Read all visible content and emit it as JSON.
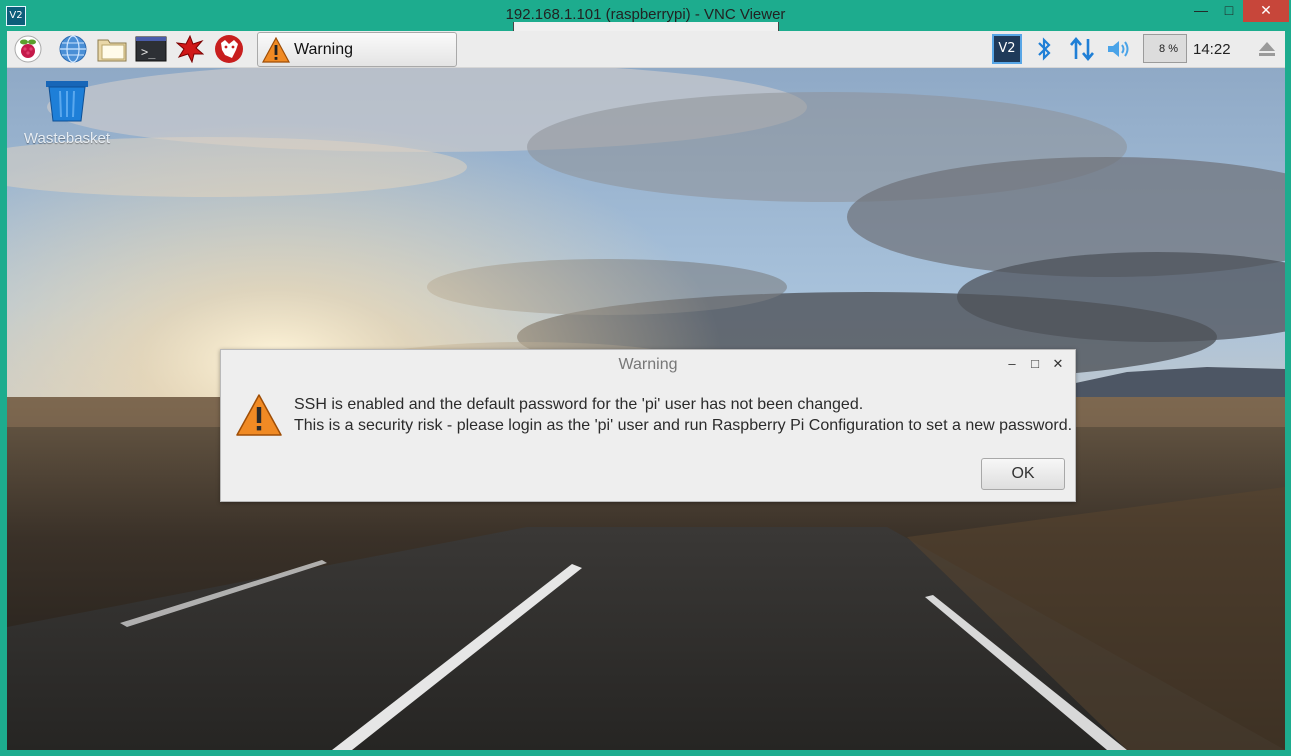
{
  "window": {
    "title": "192.168.1.101 (raspberrypi) - VNC Viewer",
    "app_icon": "V2",
    "controls": {
      "minimize": "—",
      "maximize": "□",
      "close": "✕"
    }
  },
  "panel": {
    "launchers": [
      "raspberry-menu-icon",
      "web-browser-icon",
      "file-manager-icon",
      "terminal-icon",
      "math-kernel-icon",
      "wolfram-icon"
    ],
    "task_button": {
      "label": "Warning",
      "icon": "warning-icon"
    },
    "tray": {
      "vnc_icon": "V2",
      "bluetooth_icon": "bluetooth-icon",
      "network_icon": "network-arrows-icon",
      "volume_icon": "volume-icon",
      "cpu_usage": "8 %",
      "clock": "14:22",
      "eject_icon": "eject-icon"
    }
  },
  "desktop": {
    "icons": [
      {
        "label": "Wastebasket",
        "icon": "wastebasket-icon"
      }
    ]
  },
  "dialog": {
    "title": "Warning",
    "message_line1": "SSH is enabled and the default password for the 'pi' user has not been changed.",
    "message_line2": "This is a security risk - please login as the 'pi' user and run Raspberry Pi Configuration to set a new password.",
    "ok_label": "OK",
    "controls": {
      "minimize": "–",
      "maximize": "□",
      "close": "✕"
    }
  },
  "colors": {
    "frame": "#1dac8e",
    "close_button": "#c7463a",
    "panel": "#ececec",
    "dialog_bg": "#eeeeee",
    "warning_orange": "#f08a24"
  }
}
